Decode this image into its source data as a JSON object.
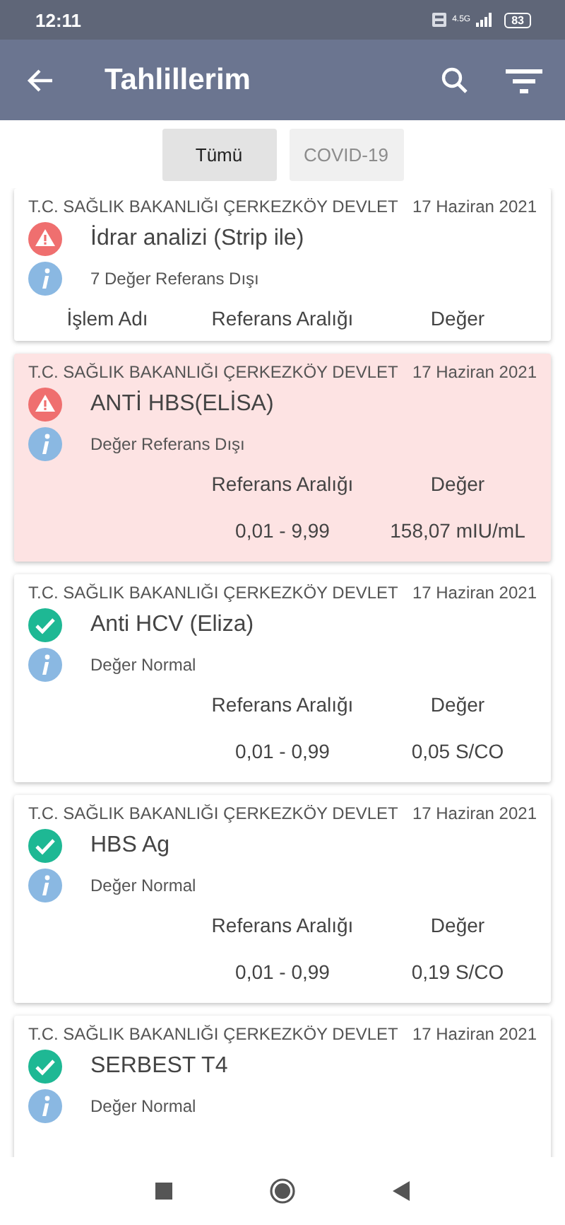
{
  "status_bar": {
    "time": "12:11",
    "network": "4.5G",
    "battery": "83"
  },
  "app_bar": {
    "title": "Tahlillerim"
  },
  "tabs": [
    {
      "label": "Tümü",
      "selected": true
    },
    {
      "label": "COVID-19",
      "selected": false
    }
  ],
  "results": [
    {
      "institution": "T.C. SAĞLIK BAKANLIĞI ÇERKEZKÖY DEVLET",
      "date": "17 Haziran 2021",
      "kind": "alert",
      "highlighted": false,
      "name": "İdrar analizi (Strip ile)",
      "note": "7 Değer Referans Dışı",
      "headers": [
        "İşlem Adı",
        "Referans Aralığı",
        "Değer"
      ]
    },
    {
      "institution": "T.C. SAĞLIK BAKANLIĞI ÇERKEZKÖY DEVLET",
      "date": "17 Haziran 2021",
      "kind": "alert",
      "highlighted": true,
      "name": "ANTİ HBS(ELİSA)",
      "note": "Değer Referans Dışı",
      "headers": [
        "Referans Aralığı",
        "Değer"
      ],
      "values": [
        "0,01 - 9,99",
        "158,07 mIU/mL"
      ]
    },
    {
      "institution": "T.C. SAĞLIK BAKANLIĞI ÇERKEZKÖY DEVLET",
      "date": "17 Haziran 2021",
      "kind": "normal",
      "highlighted": false,
      "name": "Anti HCV (Eliza)",
      "note": "Değer Normal",
      "headers": [
        "Referans Aralığı",
        "Değer"
      ],
      "values": [
        "0,01 - 0,99",
        "0,05 S/CO"
      ]
    },
    {
      "institution": "T.C. SAĞLIK BAKANLIĞI ÇERKEZKÖY DEVLET",
      "date": "17 Haziran 2021",
      "kind": "normal",
      "highlighted": false,
      "name": "HBS Ag",
      "note": "Değer Normal",
      "headers": [
        "Referans Aralığı",
        "Değer"
      ],
      "values": [
        "0,01 - 0,99",
        "0,19 S/CO"
      ]
    },
    {
      "institution": "T.C. SAĞLIK BAKANLIĞI ÇERKEZKÖY DEVLET",
      "date": "17 Haziran 2021",
      "kind": "normal",
      "highlighted": false,
      "name": "SERBEST T4",
      "note": "Değer Normal"
    }
  ]
}
